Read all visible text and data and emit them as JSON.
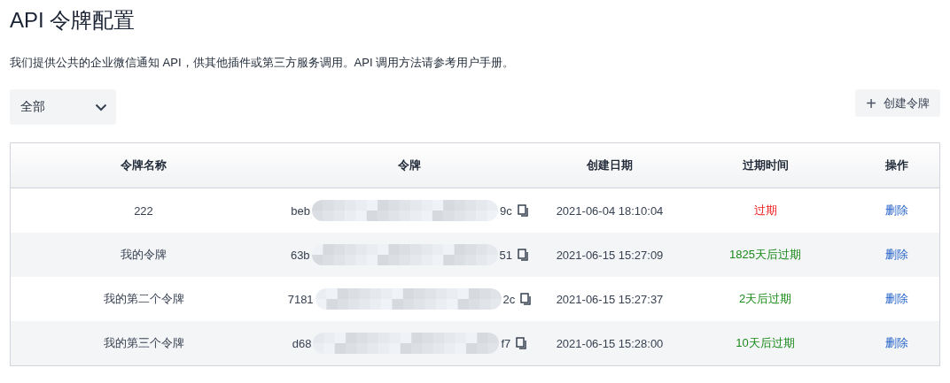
{
  "page": {
    "title": "API 令牌配置",
    "description": "我们提供公共的企业微信通知 API，供其他插件或第三方服务调用。API 调用方法请参考用户手册。"
  },
  "filter": {
    "value": "全部"
  },
  "create_button": {
    "icon": "+",
    "label": "创建令牌"
  },
  "table": {
    "columns": [
      "令牌名称",
      "令牌",
      "创建日期",
      "过期时间",
      "操作"
    ],
    "rows": [
      {
        "name": "222",
        "token_start": "beb",
        "token_end": "9c",
        "created": "2021-06-04 18:10:04",
        "expiry": "过期",
        "expired": true,
        "action": "删除"
      },
      {
        "name": "我的令牌",
        "token_start": "63b",
        "token_end": "51",
        "created": "2021-06-15 15:27:09",
        "expiry": "1825天后过期",
        "expired": false,
        "action": "删除"
      },
      {
        "name": "我的第二个令牌",
        "token_start": "7181",
        "token_end": "2c",
        "created": "2021-06-15 15:27:37",
        "expiry": "2天后过期",
        "expired": false,
        "action": "删除"
      },
      {
        "name": "我的第三个令牌",
        "token_start": "d68",
        "token_end": "f7",
        "created": "2021-06-15 15:28:00",
        "expiry": "10天后过期",
        "expired": false,
        "action": "删除"
      }
    ]
  }
}
